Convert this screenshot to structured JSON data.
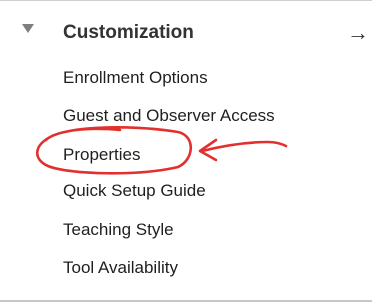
{
  "section": {
    "title": "Customization",
    "toggle_icon": "triangle-down-icon",
    "pin_icon": "arrow-right-icon",
    "pin_glyph": "→"
  },
  "menu": {
    "items": [
      {
        "label": "Enrollment Options"
      },
      {
        "label": "Guest and Observer Access"
      },
      {
        "label": "Properties"
      },
      {
        "label": "Quick Setup Guide"
      },
      {
        "label": "Teaching Style"
      },
      {
        "label": "Tool Availability"
      }
    ]
  },
  "annotation": {
    "color": "#e3302f",
    "highlighted_item": "Properties"
  }
}
